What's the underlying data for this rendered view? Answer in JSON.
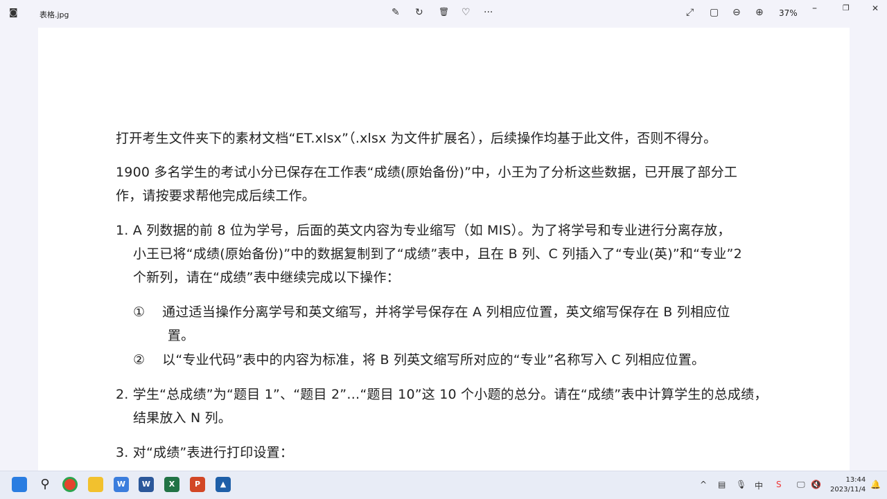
{
  "window": {
    "title": "表格.jpg",
    "zoom": "37%"
  },
  "toolbar": {
    "edit": "✎",
    "rotate": "↻",
    "delete": "🗑",
    "favorite": "♡",
    "more": "···",
    "fullscreen": "⤢",
    "fit": "▢",
    "zoom_out": "⊖",
    "zoom_in": "⊕",
    "minimize": "–",
    "restore": "❐",
    "close": "✕"
  },
  "document": {
    "lines": [
      "打开考生文件夹下的素材文档“ET.xlsx”（.xlsx 为文件扩展名），后续操作均基于此文件，否则不得分。",
      "1900 多名学生的考试小分已保存在工作表“成绩(原始备份)”中，小王为了分析这些数据，已开展了部分工",
      "作，请按要求帮他完成后续工作。",
      "1. A 列数据的前 8 位为学号，后面的英文内容为专业缩写（如 MIS）。为了将学号和专业进行分离存放，",
      "    小王已将“成绩(原始备份)”中的数据复制到了“成绩”表中，且在 B 列、C 列插入了“专业(英)”和“专业”2",
      "    个新列，请在“成绩”表中继续完成以下操作：",
      "    ①    通过适当操作分离学号和英文缩写，并将学号保存在 A 列相应位置，英文缩写保存在 B 列相应位",
      "            置。",
      "    ②    以“专业代码”表中的内容为标准，将 B 列英文缩写所对应的“专业”名称写入 C 列相应位置。",
      "2. 学生“总成绩”为“题目 1”、“题目 2”…“题目 10”这 10 个小题的总分。请在“成绩”表中计算学生的总成绩，",
      "    结果放入 N 列。",
      "3. 对“成绩”表进行打印设置："
    ]
  },
  "taskbar": {
    "apps": [
      "start",
      "search",
      "chrome",
      "explorer",
      "wps",
      "word",
      "excel",
      "powerpoint",
      "photos"
    ],
    "time": "13:44",
    "date": "2023/11/4",
    "tray_up": "^",
    "ime": "中"
  }
}
